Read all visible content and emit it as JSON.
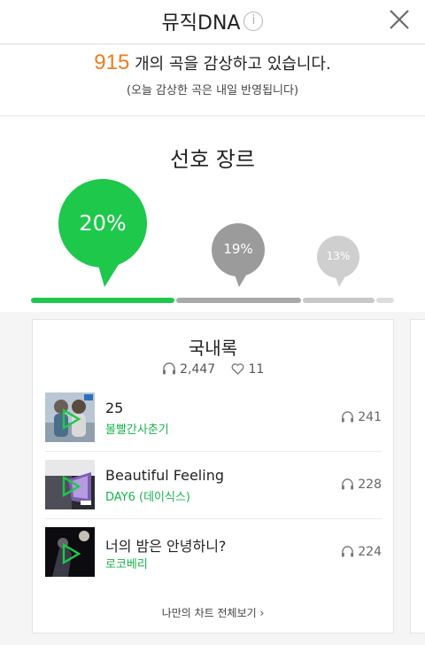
{
  "header": {
    "title": "뮤직DNA",
    "info_glyph": "i"
  },
  "summary": {
    "count": "915",
    "count_suffix": "개의 곡을 감상하고 있습니다.",
    "note": "(오늘 감상한 곡은 내일 반영됩니다)"
  },
  "genre_section": {
    "title": "선호 장르",
    "bubbles": [
      {
        "percent": "20%",
        "share": 0.2,
        "color": "#1ec84b"
      },
      {
        "percent": "19%",
        "share": 0.19,
        "color": "#9b9b9b"
      },
      {
        "percent": "13%",
        "share": 0.13,
        "color": "#cfcfcf"
      }
    ],
    "bar_colors": [
      "#1ec84b",
      "#a9a9a9",
      "#c8c8c8",
      "#dddddd"
    ]
  },
  "card": {
    "genre_name": "국내록",
    "listens": "2,447",
    "likes": "11",
    "songs": [
      {
        "title": "25",
        "artist": "볼빨간사춘기",
        "plays": "241"
      },
      {
        "title": "Beautiful Feeling",
        "artist": "DAY6 (데이식스)",
        "plays": "228"
      },
      {
        "title": "너의 밤은 안녕하니?",
        "artist": "로코베리",
        "plays": "224"
      }
    ],
    "more_label": "나만의 차트 전체보기 ›"
  },
  "colors": {
    "accent": "#1ec84b",
    "count": "#ee7d20",
    "artist": "#19b44a"
  }
}
